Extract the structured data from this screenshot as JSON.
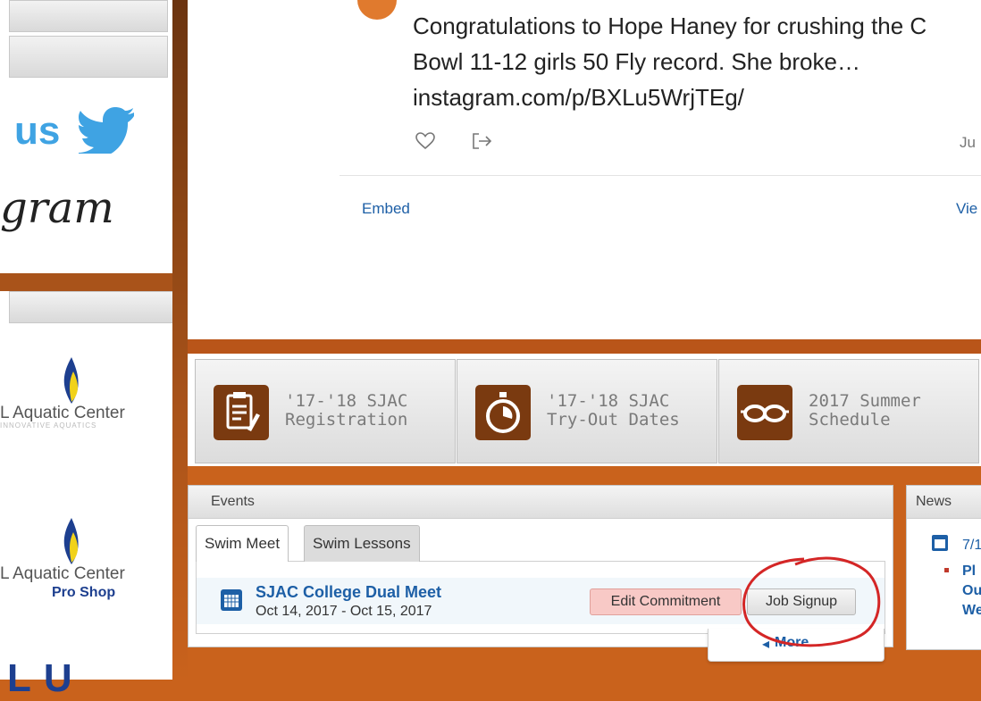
{
  "left_sidebar": {
    "twitter_text": "us",
    "instagram_text": "gram",
    "sponsor1": {
      "name": "L Aquatic Center",
      "tagline": "INNOVATIVE AQUATICS"
    },
    "sponsor2": {
      "name": "L Aquatic Center",
      "tagline": "Pro Shop"
    },
    "bottom_logo": "LU"
  },
  "tweet": {
    "text_line1": "Congratulations to Hope Haney for crushing the C",
    "text_line2": "Bowl 11-12 girls 50 Fly record.  She broke…",
    "link": "instagram.com/p/BXLu5WrjTEg/",
    "date": "Ju",
    "embed_label": "Embed",
    "view_label": "Vie"
  },
  "quick_links": [
    {
      "label_line1": "'17-'18 SJAC",
      "label_line2": "Registration",
      "icon": "clipboard-icon"
    },
    {
      "label_line1": "'17-'18 SJAC",
      "label_line2": "Try-Out Dates",
      "icon": "stopwatch-icon"
    },
    {
      "label_line1": "2017 Summer",
      "label_line2": "Schedule",
      "icon": "goggles-icon"
    }
  ],
  "events": {
    "title": "Events",
    "tabs": [
      {
        "label": "Swim Meet"
      },
      {
        "label": "Swim Lessons"
      }
    ],
    "item": {
      "title": "SJAC College Dual Meet",
      "dates": "Oct 14, 2017 - Oct 15, 2017",
      "edit_label": "Edit Commitment",
      "job_label": "Job Signup"
    },
    "more_label": "More..."
  },
  "news": {
    "title": "News",
    "date": "7/1",
    "item_line1": "Pl",
    "item_line2": "Ou",
    "item_line3": "We"
  },
  "colors": {
    "accent_brown": "#7a3a10",
    "orange_bg": "#c9621c",
    "link_blue": "#1d5fa6",
    "twitter_blue": "#3fa3e3"
  }
}
